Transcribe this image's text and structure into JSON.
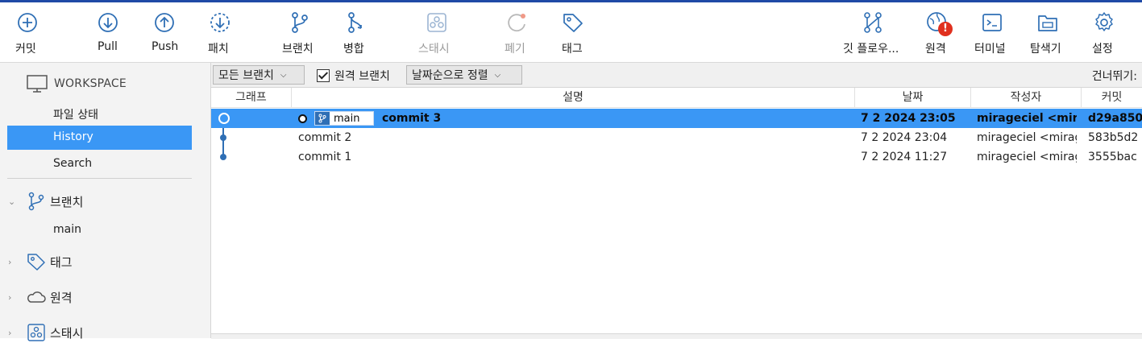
{
  "toolbar": {
    "commit": "커밋",
    "pull": "Pull",
    "push": "Push",
    "fetch": "패치",
    "branch": "브랜치",
    "merge": "병합",
    "stash": "스태시",
    "discard": "폐기",
    "tag": "태그",
    "git_flow": "깃 플로우...",
    "remote": "원격",
    "terminal": "터미널",
    "explorer": "탐색기",
    "settings": "설정"
  },
  "sidebar": {
    "workspace_label": "WORKSPACE",
    "items": [
      "파일 상태",
      "History",
      "Search"
    ],
    "selected": "History",
    "branches_label": "브랜치",
    "branch_items": [
      "main"
    ],
    "tags_label": "태그",
    "remotes_label": "원격",
    "stash_label": "스태시"
  },
  "filter": {
    "branch_select": "모든 브랜치",
    "remote_branches_label": "원격 브랜치",
    "remote_branches_checked": true,
    "sort_select": "날짜순으로 정렬",
    "skip_label": "건너뛰기:"
  },
  "table": {
    "columns": [
      "그래프",
      "설명",
      "날짜",
      "작성자",
      "커밋"
    ],
    "rows": [
      {
        "branch": "main",
        "description": "commit 3",
        "date": "7 2 2024 23:05",
        "author": "mirageciel <mirag",
        "commit": "d29a850"
      },
      {
        "branch": "",
        "description": "commit 2",
        "date": "7 2 2024 23:04",
        "author": "mirageciel <mirag",
        "commit": "583b5d2"
      },
      {
        "branch": "",
        "description": "commit 1",
        "date": "7 2 2024 11:27",
        "author": "mirageciel <mirag",
        "commit": "3555bac"
      }
    ],
    "selected_row": 0
  },
  "colors": {
    "accent": "#3a97f5",
    "icon": "#2f6fb5",
    "badge": "#e0301e"
  }
}
